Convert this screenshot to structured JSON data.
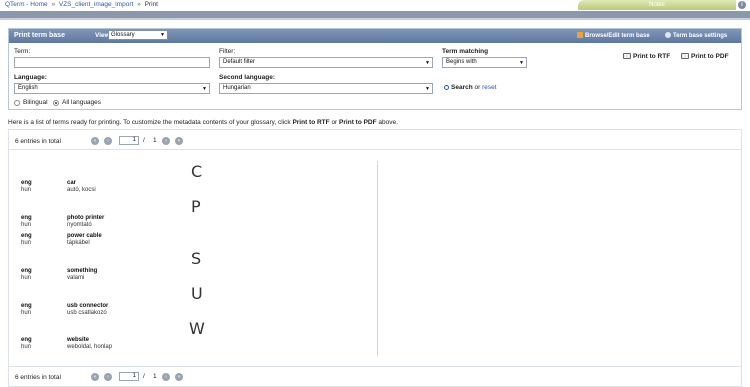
{
  "breadcrumb": {
    "items": [
      "QTerm - Home",
      "VZS_client_image_import",
      "Print"
    ],
    "separator": "»"
  },
  "user": {
    "label": "Noble"
  },
  "panel": {
    "title": "Print term base",
    "view_label": "View:",
    "view_value": "Glossary",
    "browse_link": "Browse/Edit term base",
    "settings_link": "Term base settings",
    "term_label": "Term:",
    "term_value": "",
    "filter_label": "Filter:",
    "filter_value": "Default filter",
    "matching_label": "Term matching",
    "matching_value": "Begins with",
    "language_label": "Language:",
    "language_value": "English",
    "second_language_label": "Second language:",
    "second_language_value": "Hungarian",
    "search_label": "Search",
    "or_label": "or",
    "reset_label": "reset",
    "print_rtf": "Print to RTF",
    "print_pdf": "Print to PDF",
    "bilingual_label": "Bilingual",
    "all_languages_label": "All languages"
  },
  "description": {
    "before": "Here is a list of terms ready for printing. To customize the metadata contents of your glossary, click ",
    "rtf": "Print to RTF",
    "middle": " or ",
    "pdf": "Print to PDF",
    "after": " above."
  },
  "pager": {
    "total_text": "6 entries in total",
    "page": "1",
    "slash": "/",
    "page_count": "1"
  },
  "groups": [
    {
      "letter": "C",
      "entries": [
        {
          "src_lang": "eng",
          "src_term": "car",
          "tgt_lang": "hun",
          "tgt_term": "autó, kocsi"
        }
      ]
    },
    {
      "letter": "P",
      "entries": [
        {
          "src_lang": "eng",
          "src_term": "photo printer",
          "tgt_lang": "hun",
          "tgt_term": "nyomtató"
        },
        {
          "src_lang": "eng",
          "src_term": "power cable",
          "tgt_lang": "hun",
          "tgt_term": "tápkábel"
        }
      ]
    },
    {
      "letter": "S",
      "entries": [
        {
          "src_lang": "eng",
          "src_term": "something",
          "tgt_lang": "hun",
          "tgt_term": "valami"
        }
      ]
    },
    {
      "letter": "U",
      "entries": [
        {
          "src_lang": "eng",
          "src_term": "usb connector",
          "tgt_lang": "hun",
          "tgt_term": "usb csatlakozó"
        }
      ]
    },
    {
      "letter": "W",
      "entries": [
        {
          "src_lang": "eng",
          "src_term": "website",
          "tgt_lang": "hun",
          "tgt_term": "weboldal, honlap"
        }
      ]
    }
  ],
  "colors": {
    "header": "#5d789f",
    "band": "#8b97aa",
    "link": "#2a5aa6"
  }
}
